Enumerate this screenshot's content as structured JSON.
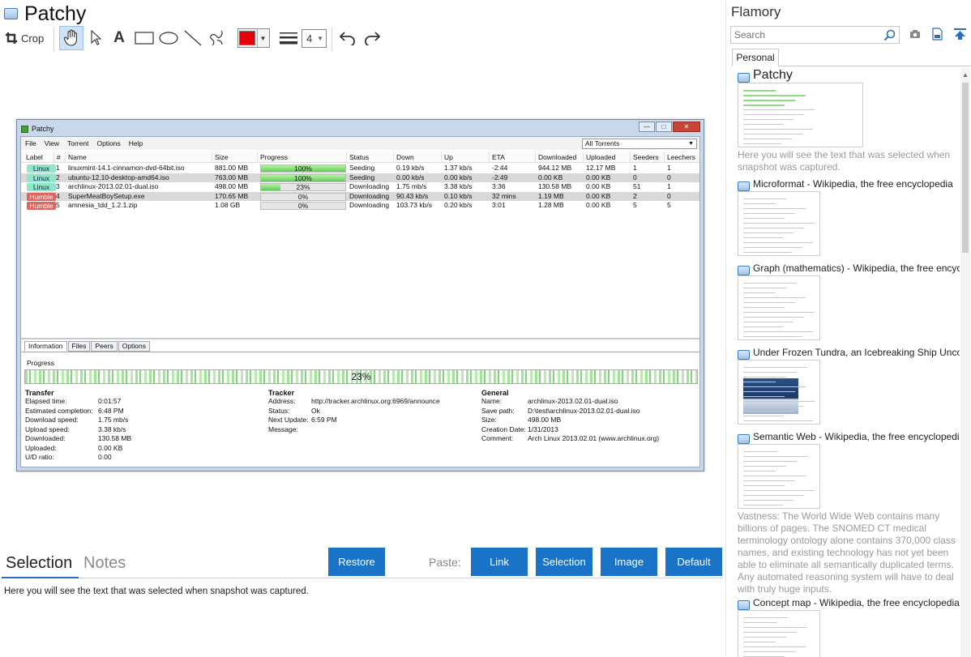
{
  "app": {
    "title": "Patchy"
  },
  "toolbar": {
    "crop_label": "Crop",
    "tools": [
      "hand-tool",
      "pointer-tool",
      "text-tool",
      "rectangle-tool",
      "ellipse-tool",
      "line-tool",
      "freehand-tool"
    ],
    "color": "#e8000b",
    "line_width": "4"
  },
  "patchy_window": {
    "title": "Patchy",
    "menu": [
      "File",
      "View",
      "Torrent",
      "Options",
      "Help"
    ],
    "filter": "All Torrents",
    "columns": [
      "Label",
      "#",
      "Name",
      "Size",
      "Progress",
      "Status",
      "Down",
      "Up",
      "ETA",
      "Downloaded",
      "Uploaded",
      "Seeders",
      "Leechers"
    ],
    "rows": [
      {
        "label": "Linux",
        "num": "1",
        "name": "linuxmint-14.1-cinnamon-dvd-64bit.iso",
        "size": "881.00 MB",
        "progress": "100%",
        "progress_value": 100,
        "status": "Seeding",
        "down": "0.19 kb/s",
        "up": "1.37 kb/s",
        "eta": "-2:44",
        "downloaded": "944.12 MB",
        "uploaded": "12.17 MB",
        "seeders": "1",
        "leechers": "1"
      },
      {
        "label": "Linux",
        "num": "2",
        "name": "ubuntu-12.10-desktop-amd64.iso",
        "size": "763.00 MB",
        "progress": "100%",
        "progress_value": 100,
        "status": "Seeding",
        "down": "0.00 kb/s",
        "up": "0.00 kb/s",
        "eta": "-2:49",
        "downloaded": "0.00 KB",
        "uploaded": "0.00 KB",
        "seeders": "0",
        "leechers": "0"
      },
      {
        "label": "Linux",
        "num": "3",
        "name": "archlinux-2013.02.01-dual.iso",
        "size": "498.00 MB",
        "progress": "23%",
        "progress_value": 23,
        "status": "Downloading",
        "down": "1.75 mb/s",
        "up": "3.38 kb/s",
        "eta": "3:36",
        "downloaded": "130.58 MB",
        "uploaded": "0.00 KB",
        "seeders": "51",
        "leechers": "1"
      },
      {
        "label": "Humble",
        "num": "4",
        "name": "SuperMeatBoySetup.exe",
        "size": "170.65 MB",
        "progress": "0%",
        "progress_value": 0,
        "status": "Downloading",
        "down": "90.43 kb/s",
        "up": "0.10 kb/s",
        "eta": "32 mins",
        "downloaded": "1.19 MB",
        "uploaded": "0.00 KB",
        "seeders": "2",
        "leechers": "0"
      },
      {
        "label": "Humble",
        "num": "5",
        "name": "amnesia_tdd_1.2.1.zip",
        "size": "1.08 GB",
        "progress": "0%",
        "progress_value": 0,
        "status": "Downloading",
        "down": "103.73 kb/s",
        "up": "0.20 kb/s",
        "eta": "3:01",
        "downloaded": "1.28 MB",
        "uploaded": "0.00 KB",
        "seeders": "5",
        "leechers": "5"
      }
    ],
    "tabs": [
      "Information",
      "Files",
      "Peers",
      "Options"
    ],
    "info": {
      "progress_label": "Progress",
      "progress_text": "23%",
      "transfer_title": "Transfer",
      "transfer": [
        {
          "k": "Elapsed time:",
          "v": "0:01:57"
        },
        {
          "k": "Estimated completion:",
          "v": "6:48 PM"
        },
        {
          "k": "Download speed:",
          "v": "1.75 mb/s"
        },
        {
          "k": "Upload speed:",
          "v": "3.38 kb/s"
        },
        {
          "k": "Downloaded:",
          "v": "130.58 MB"
        },
        {
          "k": "Uploaded:",
          "v": "0.00 KB"
        },
        {
          "k": "U/D ratio:",
          "v": "0.00"
        }
      ],
      "tracker_title": "Tracker",
      "tracker": [
        {
          "k": "Address:",
          "v": "http://tracker.archlinux.org:6969/announce"
        },
        {
          "k": "Status:",
          "v": "Ok"
        },
        {
          "k": "Next Update:",
          "v": "6:59 PM"
        },
        {
          "k": "Message:",
          "v": ""
        }
      ],
      "general_title": "General",
      "general": [
        {
          "k": "Name:",
          "v": "archlinux-2013.02.01-dual.iso"
        },
        {
          "k": "Save path:",
          "v": "D:\\test\\archlinux-2013.02.01-dual.iso"
        },
        {
          "k": "Size:",
          "v": "498.00 MB"
        },
        {
          "k": "Creation Date:",
          "v": "1/31/2013"
        },
        {
          "k": "Comment:",
          "v": "Arch Linux 2013.02.01 (www.archlinux.org)"
        }
      ]
    }
  },
  "bottom": {
    "tab_selection": "Selection",
    "tab_notes": "Notes",
    "restore": "Restore",
    "paste_label": "Paste:",
    "paste_buttons": [
      "Link",
      "Selection",
      "Image",
      "Default"
    ],
    "selection_text": "Here you will see the text that was selected when snapshot was captured."
  },
  "sidebar": {
    "title": "Flamory",
    "search_placeholder": "Search",
    "tab": "Personal",
    "items": [
      {
        "title": "Patchy",
        "desc": "Here you will see the text that was selected when snapshot was captured."
      },
      {
        "title": "Microformat - Wikipedia, the free encyclopedia",
        "desc": ""
      },
      {
        "title": "Graph (mathematics) - Wikipedia, the free encyclopedia",
        "desc": ""
      },
      {
        "title": "Under Frozen Tundra, an Icebreaking Ship Uncovers",
        "desc": ""
      },
      {
        "title": "Semantic Web - Wikipedia, the free encyclopedia",
        "desc": "Vastness: The World Wide Web contains many billions of pages. The SNOMED CT medical terminology ontology alone contains 370,000 class names, and existing technology has not yet been able to eliminate all semantically duplicated terms. Any automated reasoning system will have to deal with truly huge inputs."
      },
      {
        "title": "Concept map - Wikipedia, the free encyclopedia",
        "desc": ""
      }
    ]
  }
}
